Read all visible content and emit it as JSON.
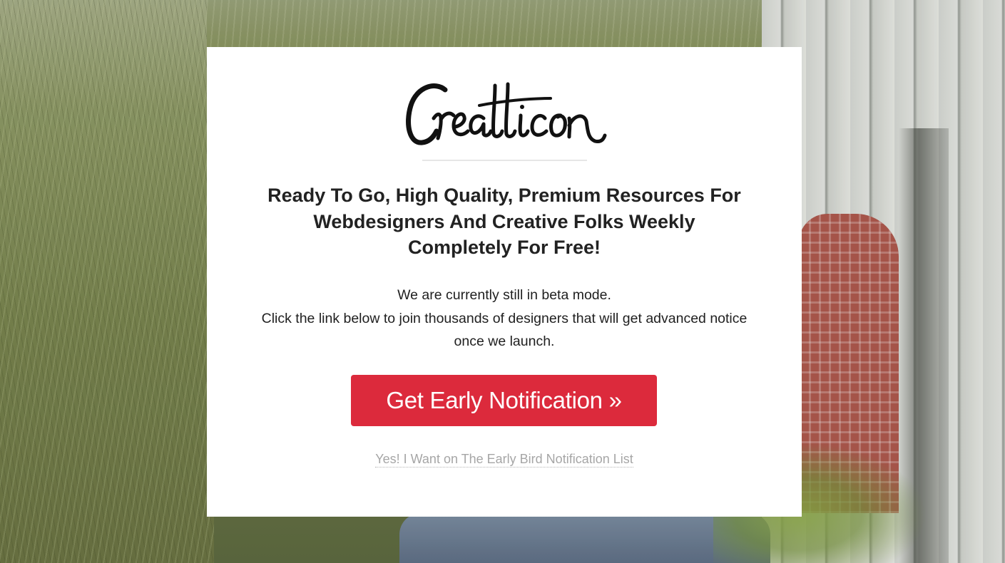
{
  "brand": {
    "logo_text": "Creatticon",
    "logo_icon": "creatticon-script-logo"
  },
  "hero": {
    "headline_line1": "Ready To Go, High Quality, Premium Resources For",
    "headline_line2": "Webdesigners And Creative Folks Weekly",
    "headline_line3": "Completely For Free!",
    "body_line1": "We are currently still in beta mode.",
    "body_line2": "Click the link below to join thousands of designers that will get advanced notice",
    "body_line3": "once we launch."
  },
  "cta": {
    "label": "Get Early Notification »",
    "color": "#dc2a3c"
  },
  "secondary": {
    "link_text": "Yes! I Want on The Early Bird Notification List"
  },
  "colors": {
    "card_background": "#ffffff",
    "headline": "#222222",
    "link": "#a6a6a6"
  }
}
